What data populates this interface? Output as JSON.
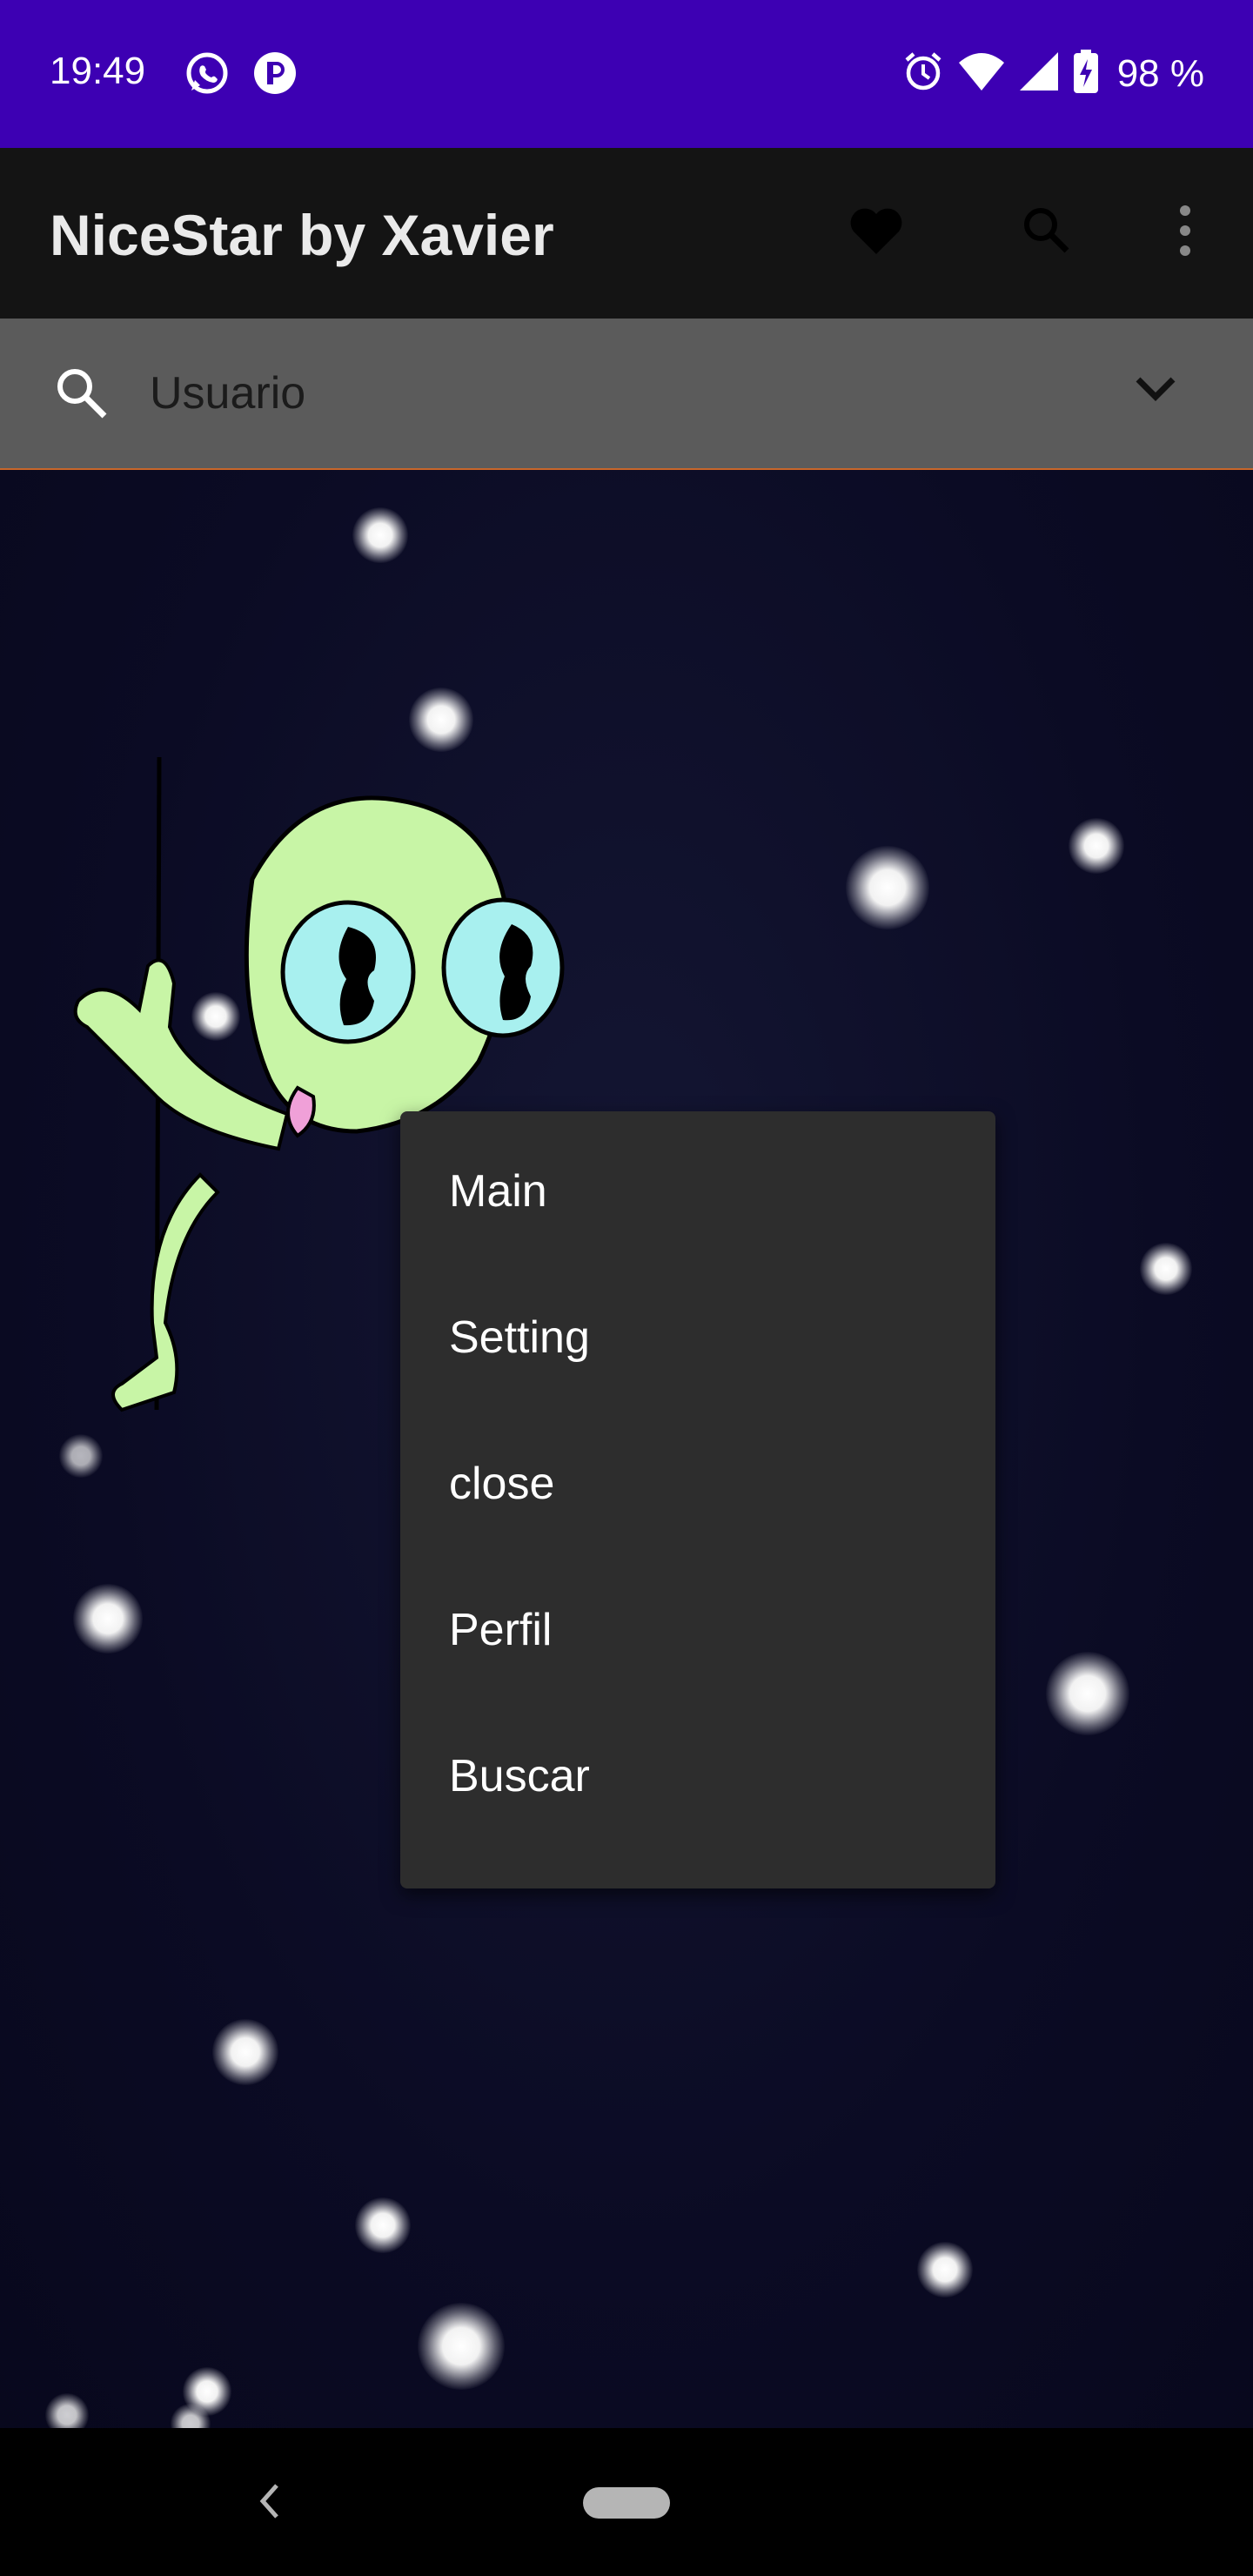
{
  "status_bar": {
    "time": "19:49",
    "battery": "98 %",
    "left_icons": [
      "whatsapp-icon",
      "app-notification-icon"
    ],
    "right_icons": [
      "alarm-icon",
      "wifi-icon",
      "signal-icon",
      "battery-charging-icon"
    ],
    "background": "#3d00b3"
  },
  "app_bar": {
    "title": "NiceStar by Xavier",
    "actions": [
      "heart-icon",
      "search-icon",
      "more-vert-icon"
    ],
    "background": "#141414"
  },
  "search_row": {
    "value": "Usuario",
    "icons": [
      "search-icon",
      "chevron-down-icon"
    ],
    "background": "#5b5b5b"
  },
  "popup_menu": {
    "items": [
      {
        "label": "Main"
      },
      {
        "label": "Setting"
      },
      {
        "label": "close"
      },
      {
        "label": "Perfil"
      },
      {
        "label": "Buscar"
      }
    ]
  },
  "nav_bar": {
    "icons": [
      "back-icon",
      "home-pill"
    ]
  },
  "colors": {
    "space_background": "#0b0b24",
    "accent_line": "#c8662a",
    "alien_skin": "#c8f5a6",
    "alien_eye": "#a8f0ef"
  }
}
